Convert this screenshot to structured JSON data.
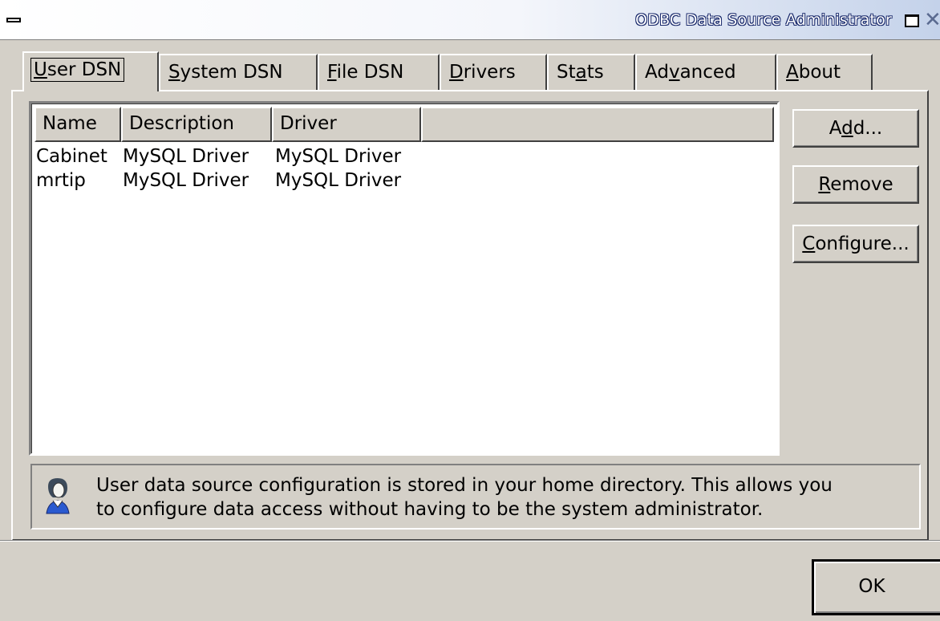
{
  "window": {
    "title": "ODBC Data Source Administrator",
    "close_glyph": "✕"
  },
  "tabs": [
    {
      "pre": "",
      "acc": "U",
      "post": "ser DSN"
    },
    {
      "pre": "",
      "acc": "S",
      "post": "ystem DSN"
    },
    {
      "pre": "",
      "acc": "F",
      "post": "ile DSN"
    },
    {
      "pre": "",
      "acc": "D",
      "post": "rivers"
    },
    {
      "pre": "St",
      "acc": "a",
      "post": "ts"
    },
    {
      "pre": "Ad",
      "acc": "v",
      "post": "anced"
    },
    {
      "pre": "",
      "acc": "A",
      "post": "bout"
    }
  ],
  "active_tab": 0,
  "list": {
    "columns": [
      "Name",
      "Description",
      "Driver"
    ],
    "rows": [
      {
        "name": "Cabinet",
        "description": "MySQL Driver",
        "driver": "MySQL Driver"
      },
      {
        "name": "mrtip",
        "description": "MySQL Driver",
        "driver": "MySQL Driver"
      }
    ]
  },
  "buttons": {
    "add": {
      "pre": "A",
      "acc": "d",
      "post": "d..."
    },
    "remove": {
      "pre": "",
      "acc": "R",
      "post": "emove"
    },
    "configure": {
      "pre": "",
      "acc": "C",
      "post": "onfigure..."
    }
  },
  "info": {
    "icon": "user-icon",
    "line1": "User data source configuration is stored in your home directory. This allows you",
    "line2": "to configure data access without having to be the system administrator."
  },
  "ok_label": "OK",
  "colors": {
    "face": "#d4d0c8",
    "titlebar_gradient_end": "#c4d2ea",
    "title_outline": "#1a2a6c"
  }
}
